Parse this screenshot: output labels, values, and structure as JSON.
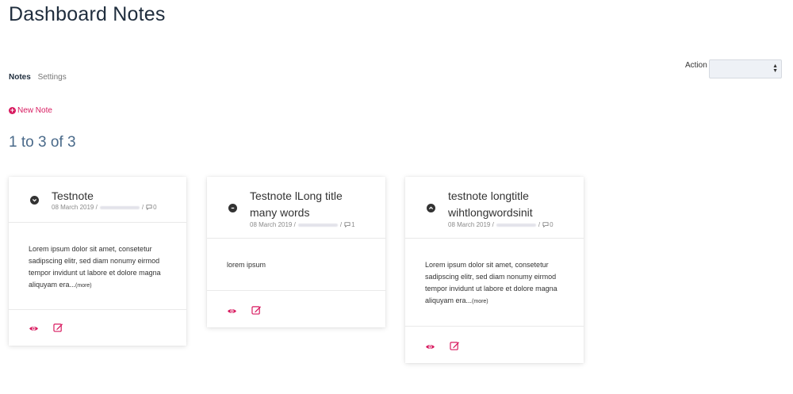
{
  "page": {
    "title": "Dashboard Notes"
  },
  "tabs": [
    {
      "label": "Notes",
      "active": true
    },
    {
      "label": "Settings",
      "active": false
    }
  ],
  "action": {
    "label": "Action",
    "selected": ""
  },
  "new_note": {
    "label": "New Note",
    "icon": "plus-circle-icon"
  },
  "pagination": {
    "range_text": "1 to 3 of 3"
  },
  "colors": {
    "accent": "#d81b60",
    "title": "#1f2d3d",
    "count": "#4a6a8a"
  },
  "notes": [
    {
      "title": "Testnote",
      "date": "08 March 2019",
      "comment_count": "0",
      "toggle_icon": "chevron-down-circle-icon",
      "body": "Lorem ipsum dolor sit amet, consetetur sadipscing elitr, sed diam nonumy eirmod tempor invidunt ut labore et dolore magna aliquyam era...",
      "more_label": "(more)"
    },
    {
      "title": "Testnote lLong title many words",
      "date": "08 March 2019",
      "comment_count": "1",
      "toggle_icon": "minus-circle-icon",
      "body": "lorem ipsum",
      "more_label": ""
    },
    {
      "title": "testnote longtitle wihtlongwordsinit",
      "date": "08 March 2019",
      "comment_count": "0",
      "toggle_icon": "chevron-up-circle-icon",
      "body": "Lorem ipsum dolor sit amet, consetetur sadipscing elitr, sed diam nonumy eirmod tempor invidunt ut labore et dolore magna aliquyam era...",
      "more_label": "(more)"
    }
  ]
}
